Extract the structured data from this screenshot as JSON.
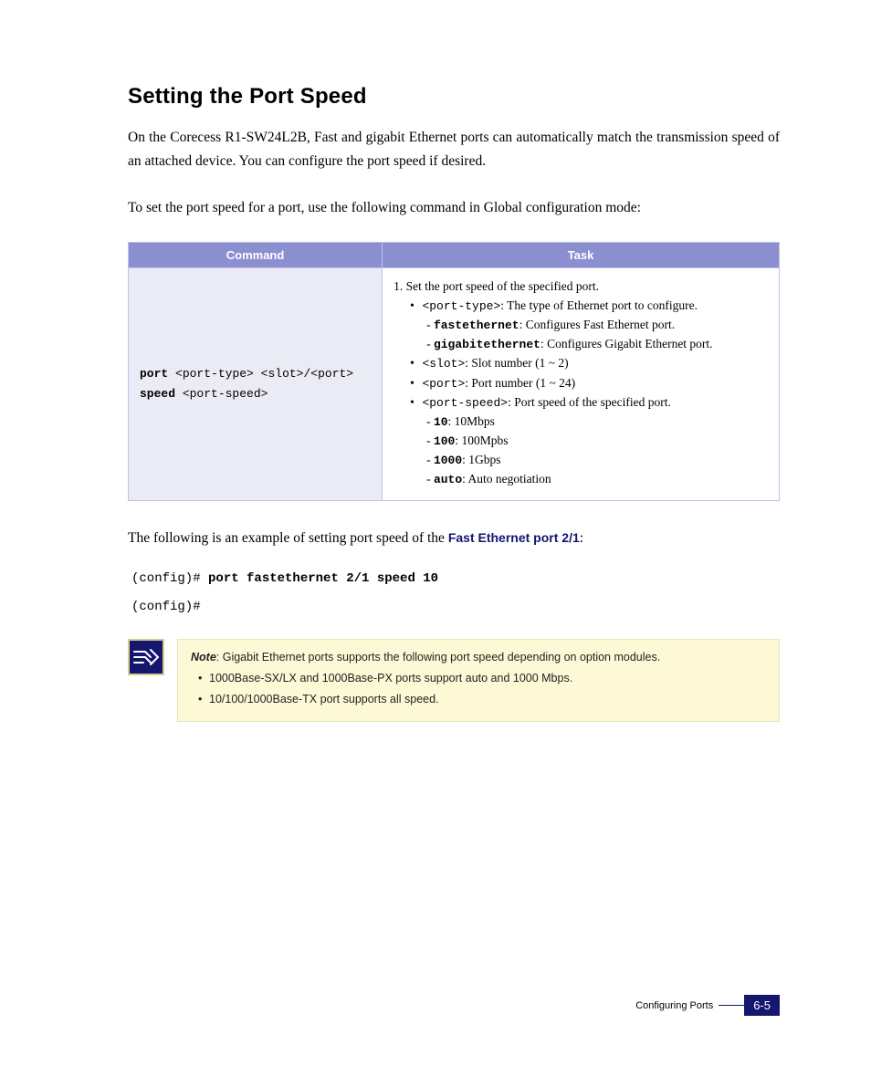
{
  "section_title": "Setting the Port Speed",
  "intro_p1": "On the Corecess R1-SW24L2B, Fast and gigabit Ethernet ports can automatically match the transmission speed of an attached device. You can configure the port speed if desired.",
  "intro_p2": "To set the port speed for a port, use the following command in Global configuration mode:",
  "table": {
    "headers": {
      "command": "Command",
      "task": "Task"
    },
    "command": {
      "kw_port": "port",
      "arg_port_type": "<port-type>",
      "arg_slot": "<slot>",
      "slash": "/",
      "arg_port": "<port>",
      "kw_speed": "speed",
      "arg_port_speed": "<port-speed>"
    },
    "task": {
      "step1": "1. Set the port speed of the specified port.",
      "pt_port_type_code": "<port-type>",
      "pt_port_type_text": ": The type of Ethernet port to configure.",
      "pt_fe_code": "fastethernet",
      "pt_fe_text": ": Configures Fast Ethernet port.",
      "pt_ge_code": "gigabitethernet",
      "pt_ge_text": ": Configures Gigabit Ethernet port.",
      "pt_slot_code": "<slot>",
      "pt_slot_text": ": Slot number (1 ~ 2)",
      "pt_port_code": "<port>",
      "pt_port_text": ": Port number (1 ~ 24)",
      "pt_speed_code": "<port-speed>",
      "pt_speed_text": ": Port speed of the specified port.",
      "sp_10_code": "10",
      "sp_10_text": ": 10Mbps",
      "sp_100_code": "100",
      "sp_100_text": ": 100Mpbs",
      "sp_1000_code": "1000",
      "sp_1000_text": ": 1Gbps",
      "sp_auto_code": "auto",
      "sp_auto_text": ": Auto negotiation"
    }
  },
  "example": {
    "lead_prefix": "The following is an example of setting port speed of the ",
    "lead_link": "Fast Ethernet port 2/1",
    "lead_suffix": ":",
    "line1_prompt": "(config)# ",
    "line1_cmd": "port fastethernet 2/1 speed 10",
    "line2_prompt": "(config)#"
  },
  "note": {
    "label": "Note",
    "text": ": Gigabit Ethernet ports supports the following port speed depending on option modules.",
    "bullet1": "1000Base-SX/LX and 1000Base-PX ports support auto and 1000 Mbps.",
    "bullet2": "10/100/1000Base-TX port supports all speed."
  },
  "footer": {
    "section": "Configuring Ports",
    "page": "6-5"
  }
}
